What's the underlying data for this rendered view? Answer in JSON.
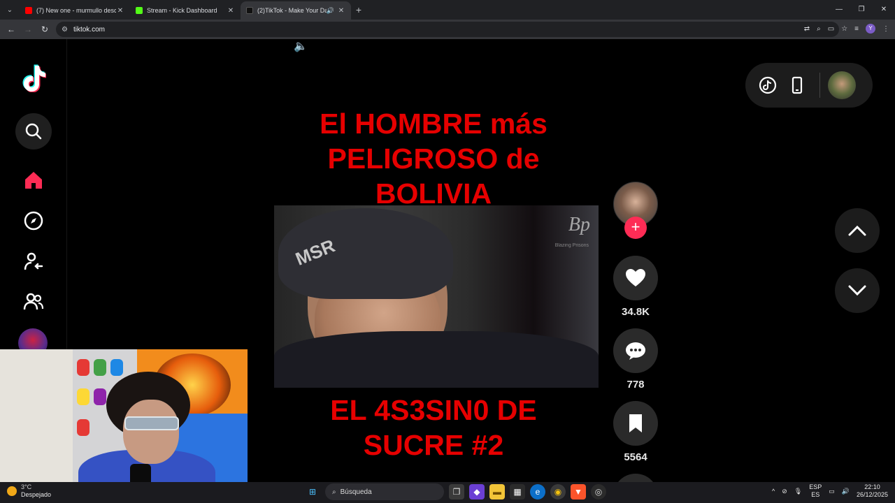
{
  "browser": {
    "tabs": [
      {
        "title": "(7) New one - murmullo descu",
        "favicon_color": "#ff0000"
      },
      {
        "title": "Stream - Kick Dashboard",
        "favicon_color": "#53fc18"
      },
      {
        "title": "(2)TikTok - Make Your Day",
        "favicon_color": "#111111",
        "active": true
      }
    ],
    "url": "tiktok.com"
  },
  "video": {
    "title_top": "El HOMBRE más PELIGROSO de BOLIVIA",
    "title_bottom": "EL 4S3SIN0 DE SUCRE #2",
    "watermark": "Bp",
    "watermark_sub": "Blazing Prisons",
    "brand_text": "MSR"
  },
  "actions": {
    "likes": "34.8K",
    "comments": "778",
    "saves": "5564"
  },
  "taskbar": {
    "weather_temp": "3°C",
    "weather_label": "Despejado",
    "search_placeholder": "Búsqueda",
    "lang_top": "ESP",
    "lang_bottom": "ES",
    "time": "22:10",
    "date": "26/12/2025"
  },
  "colors": {
    "tiktok_pink": "#fe2c55",
    "title_red": "#e60000"
  }
}
